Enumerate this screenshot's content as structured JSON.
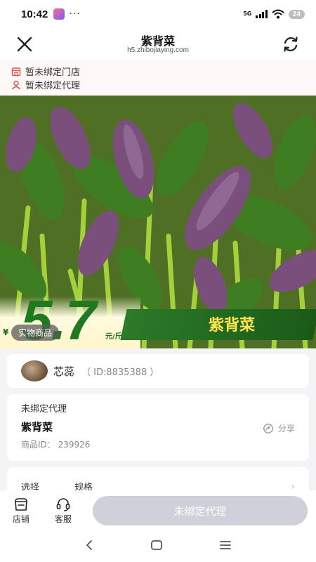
{
  "status_bar": {
    "time": "10:42",
    "dots": "···",
    "network": "5G",
    "battery": "24"
  },
  "header": {
    "title": "紫背菜",
    "domain": "h5.zhibojiaying.com"
  },
  "bind_info": {
    "store_status": "暂未绑定门店",
    "agent_status": "暂未绑定代理"
  },
  "hero": {
    "currency": "¥",
    "price": "5.7",
    "unit": "元/斤",
    "tag": "实物商品",
    "banner_name": "紫背菜"
  },
  "store": {
    "name": "芯蕊",
    "id_text": "（ ID:8835388 ）"
  },
  "product": {
    "unbound_label": "未绑定代理",
    "title": "紫背菜",
    "id_text": "商品ID： 239926",
    "share_label": "分享"
  },
  "spec": {
    "key": "选择",
    "value": "规格",
    "chevron": "›"
  },
  "bottom_bar": {
    "store_label": "店铺",
    "service_label": "客服",
    "primary_label": "未绑定代理"
  },
  "system_nav": {
    "back": "<"
  }
}
